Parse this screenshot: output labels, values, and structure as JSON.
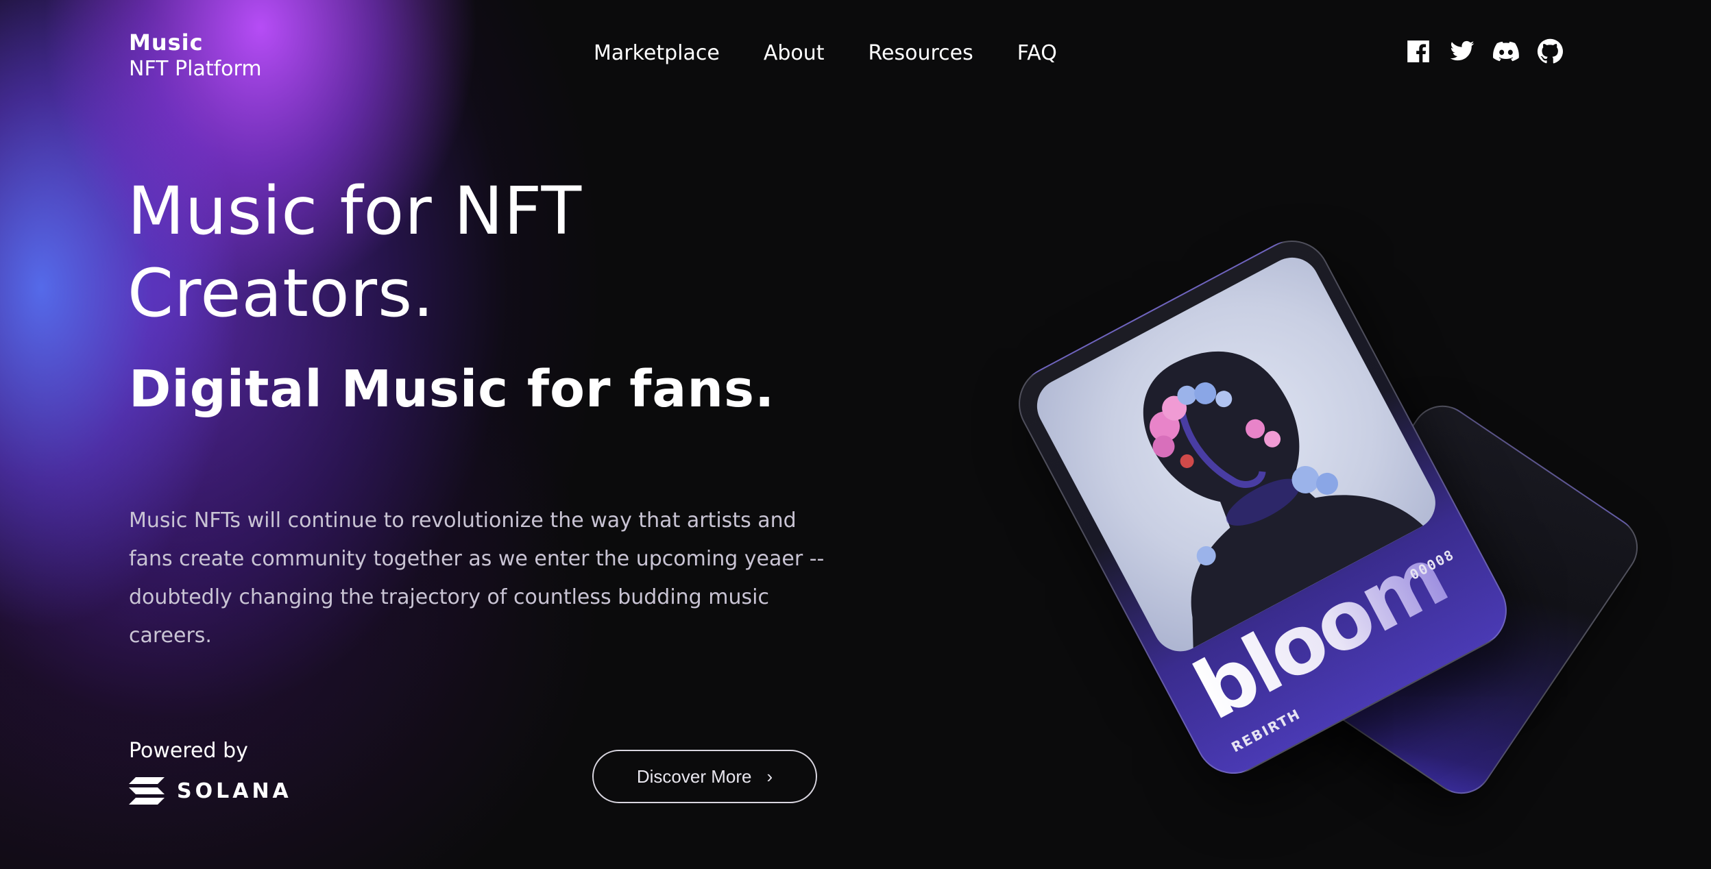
{
  "brand": {
    "line1": "Music",
    "line2": "NFT Platform"
  },
  "nav": {
    "items": [
      {
        "label": "Marketplace"
      },
      {
        "label": "About"
      },
      {
        "label": "Resources"
      },
      {
        "label": "FAQ"
      }
    ]
  },
  "social": {
    "icons": [
      "facebook-icon",
      "twitter-icon",
      "discord-icon",
      "github-icon"
    ]
  },
  "hero": {
    "title_line1": "Music for NFT",
    "title_line2": "Creators.",
    "subtitle": "Digital Music for fans.",
    "description_lines": [
      "Music NFTs will continue to revolutionize the way that artists and",
      "fans create community together as we enter the upcoming yeaer --",
      "doubtedly changing the trajectory of countless budding music",
      "careers."
    ]
  },
  "powered": {
    "label": "Powered by",
    "partner": "SOLANA"
  },
  "cta": {
    "label": "Discover More"
  },
  "card": {
    "name": "bloom",
    "number": "00008",
    "subtitle": "REBIRTH"
  },
  "colors": {
    "background": "#0b0b0c",
    "glow_purple": "#b44fff",
    "glow_blue": "#5a78ff",
    "card_accent": "#4a3ab4"
  }
}
